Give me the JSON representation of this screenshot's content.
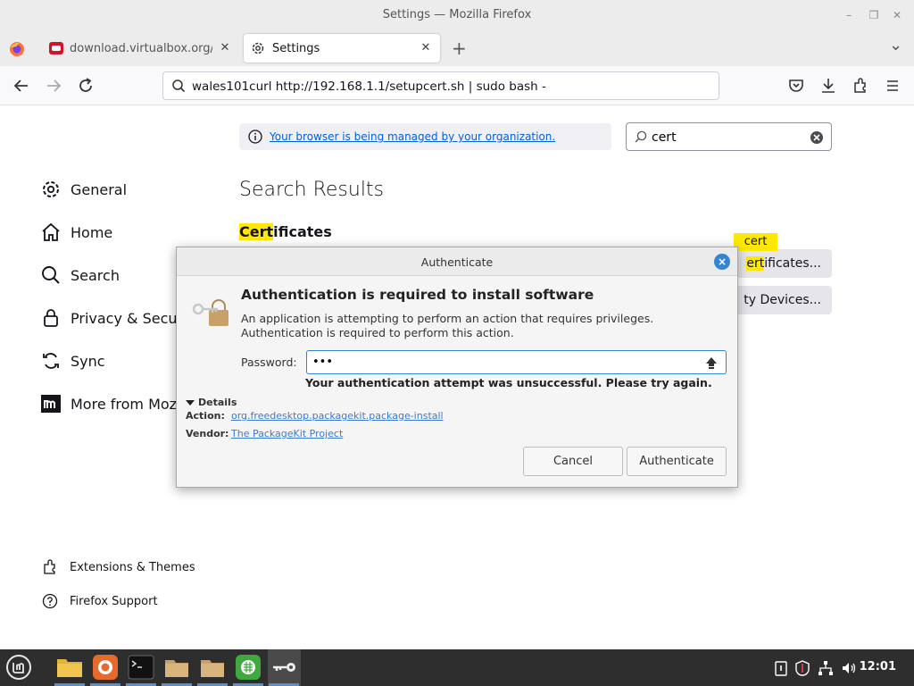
{
  "window": {
    "title": "Settings — Mozilla Firefox",
    "minimize": "–",
    "restore": "❐",
    "close": "✕"
  },
  "tabs": [
    {
      "label": "download.virtualbox.org/vi",
      "close": "✕"
    },
    {
      "label": "Settings",
      "close": "✕"
    }
  ],
  "tabstrip": {
    "new_tab": "+",
    "list_all": "⌄"
  },
  "urlbar": {
    "value": "wales101curl http://192.168.1.1/setupcert.sh | sudo bash -"
  },
  "managed_notice": {
    "text": "Your browser is being managed by your organization."
  },
  "pref_search": {
    "value": "cert"
  },
  "sidebar": {
    "items": [
      {
        "label": "General",
        "icon": "gear-icon"
      },
      {
        "label": "Home",
        "icon": "home-icon"
      },
      {
        "label": "Search",
        "icon": "search-icon"
      },
      {
        "label": "Privacy & Security",
        "icon": "lock-icon"
      },
      {
        "label": "Sync",
        "icon": "sync-icon"
      },
      {
        "label": "More from Mozilla",
        "icon": "mozilla-icon"
      }
    ],
    "footer": [
      {
        "label": "Extensions & Themes",
        "icon": "puzzle-icon"
      },
      {
        "label": "Firefox Support",
        "icon": "help-icon"
      }
    ]
  },
  "main": {
    "results_title": "Search Results",
    "section_heading_match": "Cert",
    "section_heading_rest": "ificates",
    "view_certs_match": "ert",
    "view_certs_rest": "ificates...",
    "security_devices": "ty Devices...",
    "search_badge": "cert"
  },
  "dialog": {
    "title": "Authenticate",
    "close": "×",
    "heading": "Authentication is required to install software",
    "description": "An application is attempting to perform an action that requires privileges. Authentication is required to perform this action.",
    "password_label": "Password:",
    "password_value": "•••",
    "error": "Your authentication attempt was unsuccessful. Please try again.",
    "details_label": "Details",
    "action_label": "Action:",
    "action_value": "org.freedesktop.packagekit.package-install",
    "vendor_label": "Vendor:",
    "vendor_value": "The PackageKit Project",
    "cancel": "Cancel",
    "authenticate": "Authenticate"
  },
  "taskbar": {
    "clock": "12:01",
    "apps": [
      "files-icon",
      "firefox-icon",
      "terminal-icon",
      "folder-icon",
      "folder-icon",
      "calc-icon",
      "key-icon"
    ]
  },
  "colors": {
    "highlight": "#ffe900",
    "link": "#0061e0",
    "dialog_accent": "#3484d5",
    "taskbar": "#2e2e2e"
  }
}
